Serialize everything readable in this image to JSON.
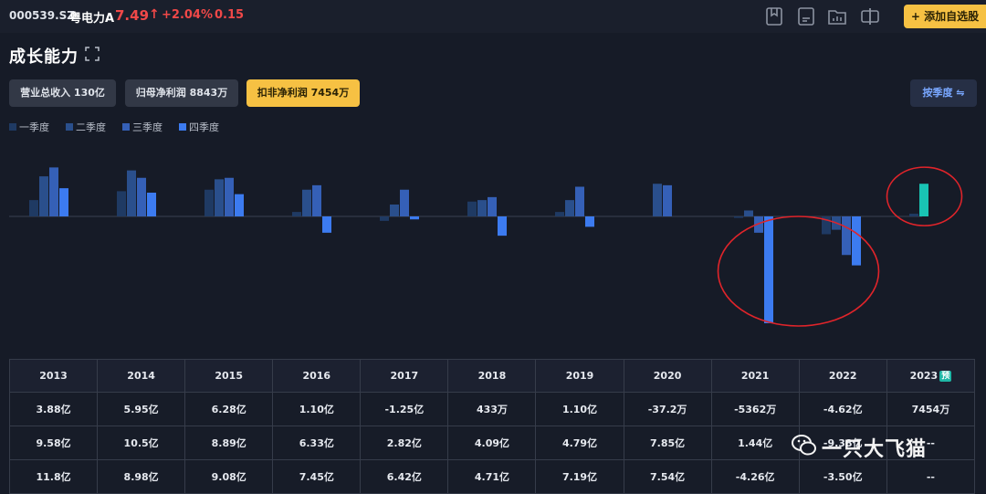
{
  "header": {
    "code": "000539.SZ",
    "name": "粤电力A",
    "price": "7.49",
    "change_pct": "+2.04%",
    "change_amt": "0.15",
    "add_button": "+ 添加自选股",
    "icons": [
      "bookmark-icon",
      "document-icon",
      "folder-chart-icon",
      "split-view-icon"
    ]
  },
  "section": {
    "title": "成长能力",
    "metrics": [
      {
        "label": "营业总收入 130亿",
        "active": false
      },
      {
        "label": "归母净利润 8843万",
        "active": false
      },
      {
        "label": "扣非净利润 7454万",
        "active": true
      }
    ],
    "season_button": "按季度 ⇋"
  },
  "legend": [
    "一季度",
    "二季度",
    "三季度",
    "四季度"
  ],
  "colors": {
    "q1": "#1f3a63",
    "q2": "#2a4f8c",
    "q3": "#3560b7",
    "q4": "#3c7bf0",
    "highlight": "#19c4b4",
    "circle": "#e0242a",
    "up": "#f04848",
    "accent": "#f6c143"
  },
  "chart_data": {
    "type": "bar",
    "title": "",
    "xlabel": "",
    "ylabel": "",
    "categories": [
      "2013",
      "2014",
      "2015",
      "2016",
      "2017",
      "2018",
      "2019",
      "2020",
      "2021",
      "2022",
      "2023"
    ],
    "ylim": [
      -3.6,
      1.9
    ],
    "unit": "亿",
    "series": [
      {
        "name": "一季度",
        "values": [
          0.55,
          0.85,
          0.9,
          0.15,
          -0.15,
          0.5,
          0.15,
          0.0,
          -0.05,
          -0.6,
          0.09
        ]
      },
      {
        "name": "二季度",
        "values": [
          1.35,
          1.55,
          1.25,
          0.9,
          0.4,
          0.55,
          0.55,
          1.1,
          0.2,
          -0.45,
          1.1
        ]
      },
      {
        "name": "三季度",
        "values": [
          1.65,
          1.3,
          1.3,
          1.05,
          0.9,
          0.65,
          1.0,
          1.05,
          -0.55,
          -1.3,
          null
        ]
      },
      {
        "name": "四季度",
        "values": [
          0.95,
          0.8,
          0.75,
          -0.55,
          -0.1,
          -0.65,
          -0.35,
          0.0,
          -3.6,
          -1.65,
          null
        ]
      }
    ],
    "highlight": {
      "category": "2023",
      "series": "二季度"
    },
    "annotations": [
      {
        "type": "circle",
        "category": "2021",
        "series": "四季度",
        "color": "#e0242a"
      },
      {
        "type": "circle",
        "category": "2023",
        "series": "二季度",
        "color": "#e0242a"
      }
    ]
  },
  "table": {
    "headers": [
      "2013",
      "2014",
      "2015",
      "2016",
      "2017",
      "2018",
      "2019",
      "2020",
      "2021",
      "2022",
      "2023"
    ],
    "pred_badge": "预",
    "rows": [
      [
        "3.88亿",
        "5.95亿",
        "6.28亿",
        "1.10亿",
        "-1.25亿",
        "433万",
        "1.10亿",
        "-37.2万",
        "-5362万",
        "-4.62亿",
        "7454万"
      ],
      [
        "9.58亿",
        "10.5亿",
        "8.89亿",
        "6.33亿",
        "2.82亿",
        "4.09亿",
        "4.79亿",
        "7.85亿",
        "1.44亿",
        "-9.38亿",
        "--"
      ],
      [
        "11.8亿",
        "8.98亿",
        "9.08亿",
        "7.45亿",
        "6.42亿",
        "4.71亿",
        "7.19亿",
        "7.54亿",
        "-4.26亿",
        "-3.50亿",
        "--"
      ]
    ]
  },
  "watermark": "一只大飞猫"
}
